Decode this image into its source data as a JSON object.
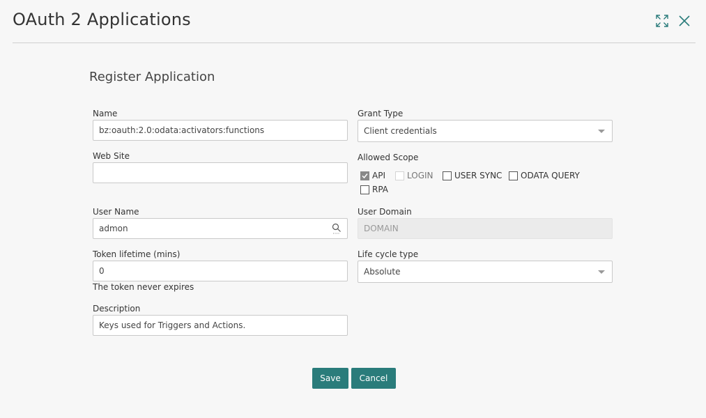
{
  "header": {
    "title": "OAuth 2 Applications"
  },
  "section": {
    "title": "Register Application"
  },
  "form": {
    "name": {
      "label": "Name",
      "value": "bz:oauth:2.0:odata:activators:functions"
    },
    "website": {
      "label": "Web Site",
      "value": ""
    },
    "username": {
      "label": "User Name",
      "value": "admon"
    },
    "token_lifetime": {
      "label": "Token lifetime (mins)",
      "value": "0",
      "note": "The token never expires"
    },
    "description": {
      "label": "Description",
      "value": "Keys used for Triggers and Actions."
    },
    "grant_type": {
      "label": "Grant Type",
      "value": "Client credentials"
    },
    "allowed_scope": {
      "label": "Allowed Scope",
      "options": [
        {
          "label": "API",
          "checked": true,
          "disabled": false
        },
        {
          "label": "LOGIN",
          "checked": false,
          "disabled": true
        },
        {
          "label": "USER SYNC",
          "checked": false,
          "disabled": false
        },
        {
          "label": "ODATA QUERY",
          "checked": false,
          "disabled": false
        },
        {
          "label": "RPA",
          "checked": false,
          "disabled": false
        }
      ]
    },
    "user_domain": {
      "label": "User Domain",
      "value": "DOMAIN"
    },
    "life_cycle": {
      "label": "Life cycle type",
      "value": "Absolute"
    }
  },
  "buttons": {
    "save": "Save",
    "cancel": "Cancel"
  },
  "colors": {
    "accent": "#2a7c7b",
    "background": "#f7f7f7"
  }
}
